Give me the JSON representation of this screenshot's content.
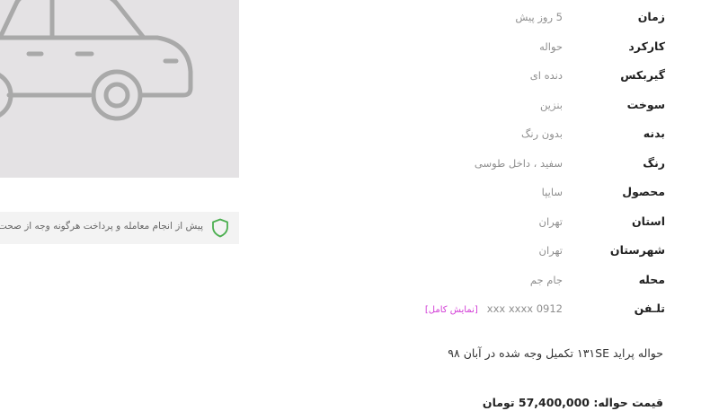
{
  "notice": {
    "text": "پیش از انجام معامله و پرداخت هرگونه وجه از صحت"
  },
  "details": [
    {
      "label": "زمان",
      "value": "5 روز پیش"
    },
    {
      "label": "کارکرد",
      "value": "حواله"
    },
    {
      "label": "گیربکس",
      "value": "دنده ای"
    },
    {
      "label": "سوخت",
      "value": "بنزین"
    },
    {
      "label": "بدنه",
      "value": "بدون رنگ"
    },
    {
      "label": "رنگ",
      "value": "سفید ، داخل طوسی"
    },
    {
      "label": "محصول",
      "value": "سایپا"
    },
    {
      "label": "استان",
      "value": "تهران"
    },
    {
      "label": "شهرستان",
      "value": "تهران"
    },
    {
      "label": "محله",
      "value": "جام جم"
    },
    {
      "label": "تلـفن",
      "value": "0912 xxx xxxx",
      "action": "[نمایش کامل]"
    }
  ],
  "description": "حواله پراید ۱۳۱SE تکمیل وجه شده در آبان ۹۸",
  "price": "قیمت حواله: 57,400,000 تومان",
  "colors": {
    "image_bg": "#e4e2e4",
    "car_stroke": "#a9a9a9",
    "shield": "#4caf50",
    "link": "#d23bd6"
  }
}
